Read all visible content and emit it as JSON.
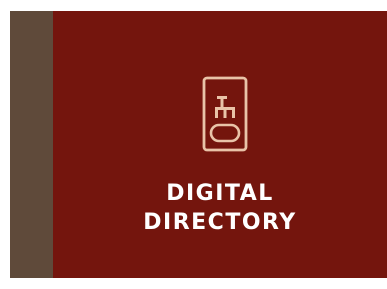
{
  "tile": {
    "title_line_1": "DIGITAL",
    "title_line_2": "DIRECTORY",
    "icon": "directory-kiosk-icon"
  },
  "colors": {
    "tile_background": "#74150d",
    "side_strip": "#5f4a3a",
    "icon_stroke": "#e9c3a8",
    "title_text": "#ffffff"
  }
}
